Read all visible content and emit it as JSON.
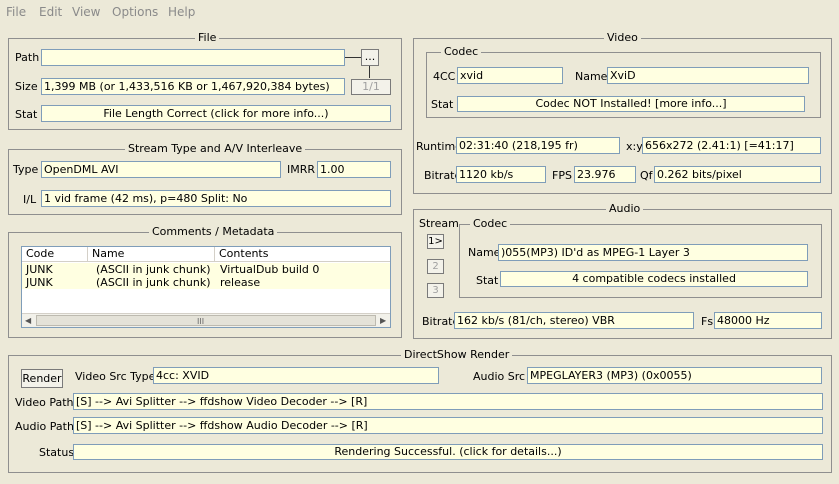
{
  "menu": [
    "File",
    "Edit",
    "View",
    "Options",
    "Help"
  ],
  "file": {
    "title": "File",
    "path_label": "Path",
    "path_value": "",
    "browse_label": "...",
    "size_label": "Size",
    "size_value": "1,399 MB (or 1,433,516 KB or 1,467,920,384 bytes)",
    "counter": "1/1",
    "stat_label": "Stat",
    "stat_value": "File Length Correct (click for more info...)"
  },
  "stream": {
    "title": "Stream Type and A/V Interleave",
    "type_label": "Type",
    "type_value": "OpenDML AVI",
    "imrr_label": "IMRR",
    "imrr_value": "1.00",
    "il_label": "I/L",
    "il_value": "1 vid frame (42 ms), p=480  Split: No"
  },
  "comments": {
    "title": "Comments / Metadata",
    "headers": [
      "Code",
      "Name",
      "Contents"
    ],
    "rows": [
      [
        "JUNK",
        "(ASCII in junk chunk)",
        "VirtualDub build 0"
      ],
      [
        "JUNK",
        "(ASCII in junk chunk)",
        "release"
      ]
    ],
    "scroll_left": "◀",
    "scroll_mid": "III",
    "scroll_right": "▶"
  },
  "video": {
    "title": "Video",
    "codec_title": "Codec",
    "fourcc_label": "4CC",
    "fourcc_value": "xvid",
    "name_label": "Name",
    "name_value": "XviD",
    "stat_label": "Stat",
    "stat_value": "Codec NOT Installed!  [more info...]",
    "runtime_label": "Runtime",
    "runtime_value": "02:31:40 (218,195 fr)",
    "xy_label": "x:y",
    "xy_value": "656x272 (2.41:1) [=41:17]",
    "bitrate_label": "Bitrate",
    "bitrate_value": "1120 kb/s",
    "fps_label": "FPS",
    "fps_value": "23.976",
    "qf_label": "Qf",
    "qf_value": "0.262 bits/pixel"
  },
  "audio": {
    "title": "Audio",
    "stream_label": "Stream",
    "codec_title": "Codec",
    "streams": [
      "1>",
      "2",
      "3"
    ],
    "name_label": "Name",
    "name_value": ")055(MP3) ID'd as MPEG-1 Layer 3",
    "stat_label": "Stat",
    "stat_value": "4 compatible codecs installed",
    "bitrate_label": "Bitrate",
    "bitrate_value": "162 kb/s (81/ch, stereo) VBR",
    "fs_label": "Fs",
    "fs_value": "48000 Hz"
  },
  "directshow": {
    "title": "DirectShow Render",
    "render_label": "Render",
    "vsrc_label": "Video Src Type",
    "vsrc_value": "4cc: XVID",
    "asrc_label": "Audio Src",
    "asrc_value": "MPEGLAYER3 (MP3) (0x0055)",
    "vpath_label": "Video Path",
    "vpath_value": "[S] --> Avi Splitter --> ffdshow Video Decoder --> [R]",
    "apath_label": "Audio Path",
    "apath_value": "[S] --> Avi Splitter --> ffdshow Audio Decoder --> [R]",
    "status_label": "Status",
    "status_value": "Rendering Successful.  (click for details...)"
  }
}
